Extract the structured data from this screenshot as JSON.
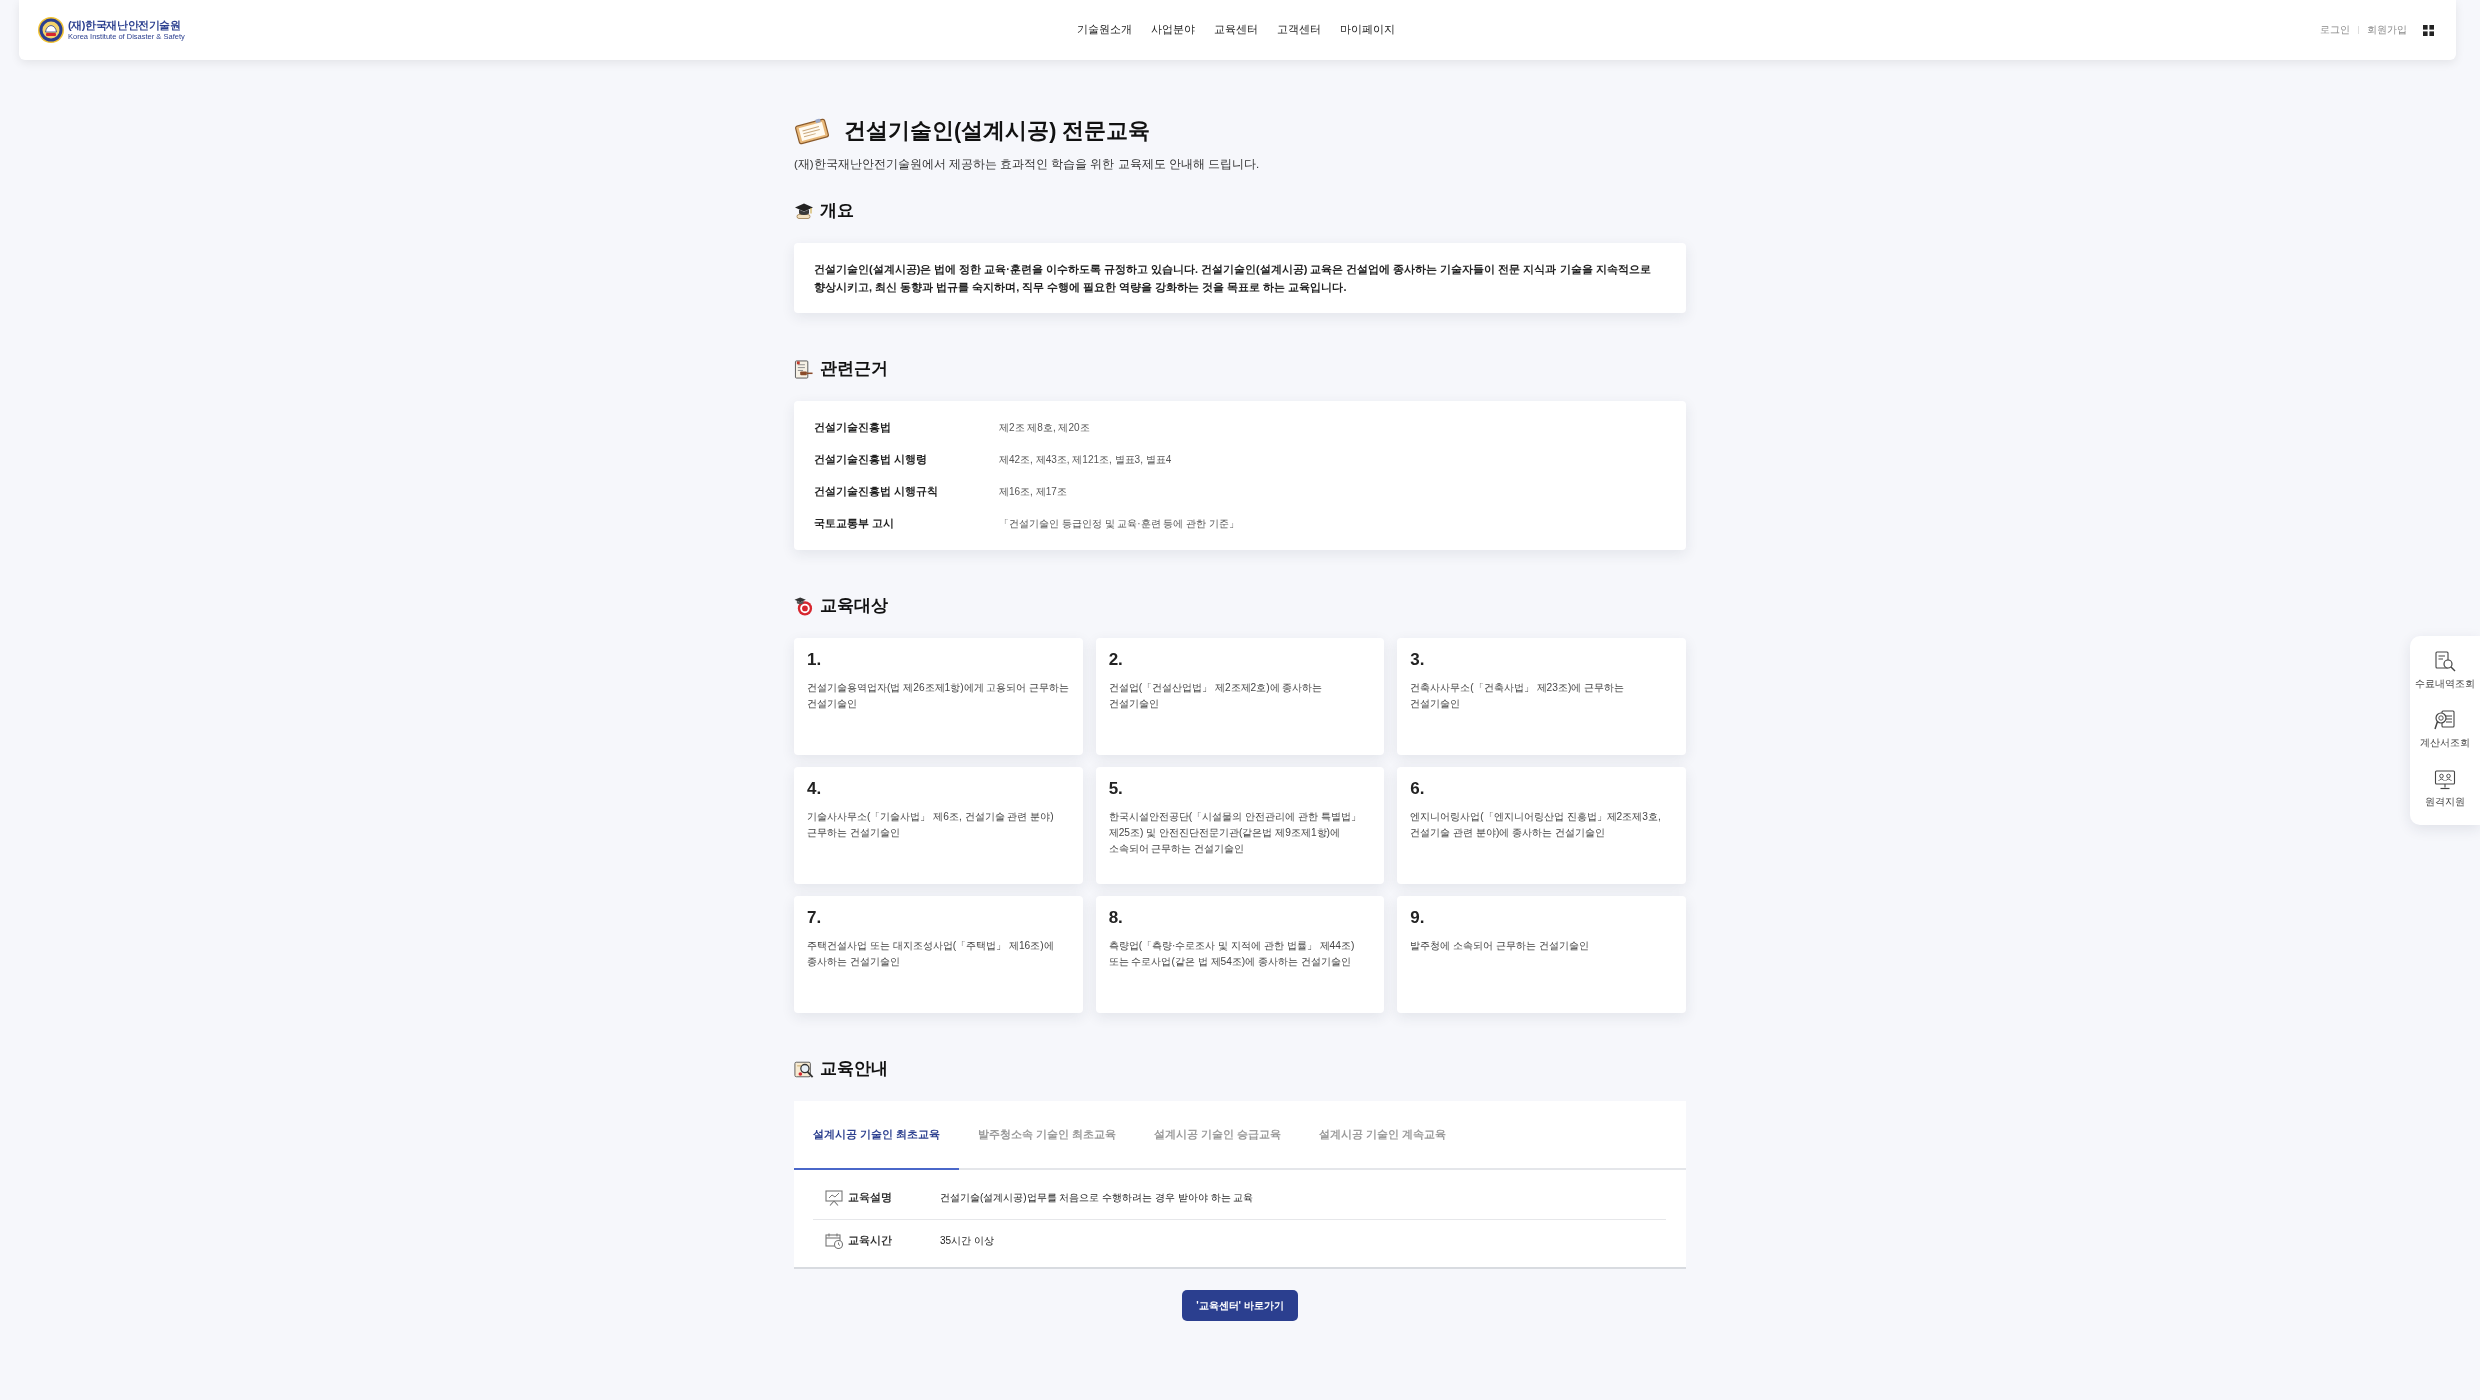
{
  "header": {
    "logo": {
      "name": "(재)한국재난안전기술원",
      "tagline": "Korea Institute of Disaster & Safety"
    },
    "nav": [
      "기술원소개",
      "사업분야",
      "교육센터",
      "고객센터",
      "마이페이지"
    ],
    "account_links": [
      "로그인",
      "회원가입"
    ]
  },
  "page": {
    "title": "건설기술인(설계시공) 전문교육",
    "subtitle": "(재)한국재난안전기술원에서 제공하는 효과적인 학습을 위한 교육제도 안내해 드립니다."
  },
  "overview": {
    "heading": "개요",
    "text": "건설기술인(설계시공)은 법에 정한 교육·훈련을 이수하도록 규정하고 있습니다. 건설기술인(설계시공) 교육은 건설업에 종사하는 기술자들이 전문 지식과 기술을 지속적으로 향상시키고, 최신 동향과 법규를 숙지하며, 직무 수행에 필요한 역량을 강화하는 것을 목표로 하는 교육입니다."
  },
  "legal_basis": {
    "heading": "관련근거",
    "rows": [
      {
        "law": "건설기술진흥법",
        "articles": "제2조 제8호, 제20조"
      },
      {
        "law": "건설기술진흥법 시행령",
        "articles": "제42조, 제43조, 제121조, 별표3, 별표4"
      },
      {
        "law": "건설기술진흥법 시행규칙",
        "articles": "제16조, 제17조"
      },
      {
        "law": "국토교통부 고시",
        "articles": "「건설기술인 등급인정 및 교육·훈련 등에 관한 기준」"
      }
    ]
  },
  "targets": {
    "heading": "교육대상",
    "items": [
      {
        "number": "1.",
        "text": "건설기술용역업자(법 제26조제1항)에게 고용되어 근무하는 건설기술인"
      },
      {
        "number": "2.",
        "text": "건설업(「건설산업법」 제2조제2호)에 종사하는 건설기술인"
      },
      {
        "number": "3.",
        "text": "건축사사무소(「건축사법」 제23조)에 근무하는 건설기술인"
      },
      {
        "number": "4.",
        "text": "기술사사무소(「기술사법」 제6조, 건설기술 관련 분야) 근무하는 건설기술인"
      },
      {
        "number": "5.",
        "text": "한국시설안전공단(「시설물의 안전관리에 관한 특별법」 제25조) 및 안전진단전문기관(같은법 제9조제1항)에 소속되어 근무하는 건설기술인"
      },
      {
        "number": "6.",
        "text": "엔지니어링사업(「엔지니어링산업 진흥법」제2조제3호, 건설기술 관련 분야)에 종사하는 건설기술인"
      },
      {
        "number": "7.",
        "text": "주택건설사업 또는 대지조성사업(「주택법」 제16조)에 종사하는 건설기술인"
      },
      {
        "number": "8.",
        "text": "측량업(「측량·수로조사 및 지적에 관한 법률」 제44조) 또는 수로사업(같은 법 제54조)에 종사하는 건설기술인"
      },
      {
        "number": "9.",
        "text": "발주청에 소속되어 근무하는 건설기술인"
      }
    ]
  },
  "guide": {
    "heading": "교육안내",
    "tabs": [
      {
        "label": "설계시공 기술인 최초교육",
        "selected": true
      },
      {
        "label": "발주청소속 기술인 최초교육",
        "selected": false
      },
      {
        "label": "설계시공 기술인 승급교육",
        "selected": false
      },
      {
        "label": "설계시공 기술인 계속교육",
        "selected": false
      }
    ],
    "rows": [
      {
        "label": "교육설명",
        "value": "건설기술(설계시공)업무를 처음으로 수행하려는 경우 받아야 하는 교육"
      },
      {
        "label": "교육시간",
        "value": "35시간 이상"
      }
    ],
    "button": "'교육센터' 바로가기"
  },
  "quick_menu": [
    "수료내역조회",
    "계산서조회",
    "원격지원"
  ]
}
